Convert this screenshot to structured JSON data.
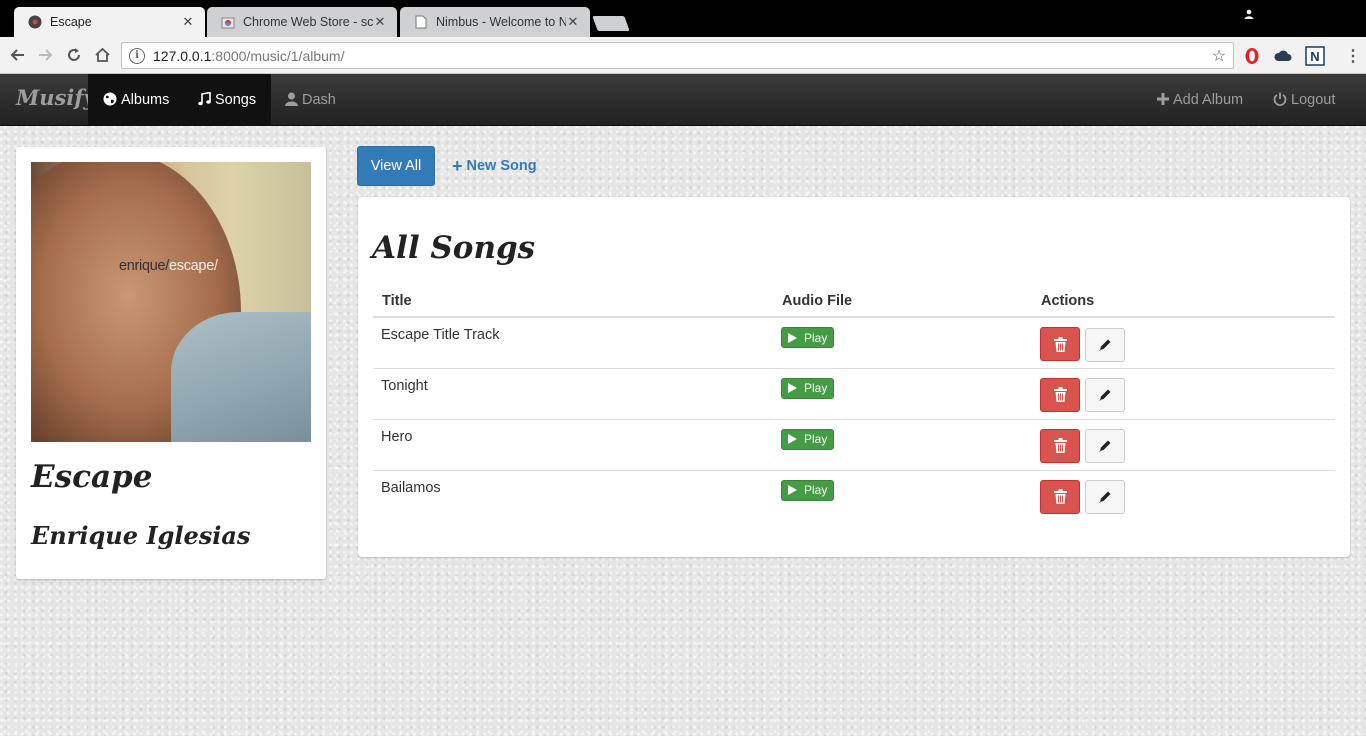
{
  "browser": {
    "tabs": [
      {
        "title": "Escape",
        "active": true
      },
      {
        "title": "Chrome Web Store - scre",
        "active": false
      },
      {
        "title": "Nimbus - Welcome to Ni",
        "active": false
      }
    ],
    "url_host": "127.0.0.1",
    "url_path": ":8000/music/1/album/",
    "icons": [
      "back-icon",
      "forward-icon",
      "reload-icon",
      "home-icon",
      "info-icon",
      "star-icon",
      "opera-icon",
      "cloud-icon",
      "nimbus-icon",
      "menu-icon"
    ]
  },
  "navbar": {
    "brand": "Musify",
    "items": [
      {
        "label": "Albums",
        "icon": "globe-icon",
        "active": true
      },
      {
        "label": "Songs",
        "icon": "music-icon",
        "active": true
      },
      {
        "label": "Dash",
        "icon": "user-icon",
        "active": false
      }
    ],
    "right_items": [
      {
        "label": "Add Album",
        "icon": "plus-icon"
      },
      {
        "label": "Logout",
        "icon": "power-icon"
      }
    ]
  },
  "album": {
    "cover_text_dark": "enrique/",
    "cover_text_light": "escape/",
    "title": "Escape",
    "artist": "Enrique Iglesias"
  },
  "actions": {
    "view_all": "View All",
    "new_song": "New Song"
  },
  "songs_panel": {
    "title": "All Songs",
    "columns": [
      "Title",
      "Audio File",
      "Actions"
    ],
    "rows": [
      {
        "title": "Escape Title Track",
        "play_label": "Play"
      },
      {
        "title": "Tonight",
        "play_label": "Play"
      },
      {
        "title": "Hero",
        "play_label": "Play"
      },
      {
        "title": "Bailamos",
        "play_label": "Play"
      }
    ]
  },
  "colors": {
    "primary": "#337ab7",
    "success": "#449d44",
    "danger": "#d9534f",
    "navbar": "#222222"
  }
}
